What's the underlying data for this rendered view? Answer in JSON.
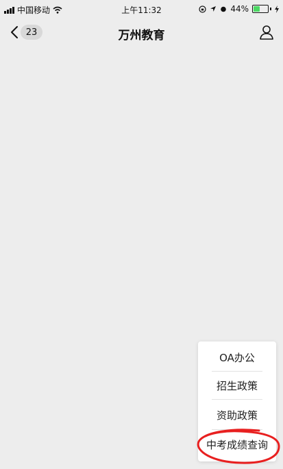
{
  "status_bar": {
    "carrier": "中国移动",
    "time": "上午11:32",
    "battery_text": "44%",
    "battery_level": 0.44,
    "battery_color": "#4cd964"
  },
  "nav": {
    "back_icon": "chevron-left-icon",
    "unread_count": "23",
    "title": "万州教育",
    "profile_icon": "user-icon"
  },
  "menu": {
    "items": [
      {
        "label": "OA办公"
      },
      {
        "label": "招生政策"
      },
      {
        "label": "资助政策"
      },
      {
        "label": "中考成绩查询"
      }
    ]
  },
  "annotation": {
    "color": "#e82020"
  }
}
